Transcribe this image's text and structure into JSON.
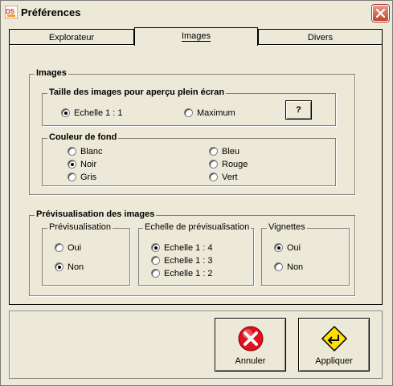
{
  "window": {
    "title": "Préférences",
    "app_icon": "ds-app-icon",
    "close_icon": "close-icon"
  },
  "tabs": [
    {
      "label": "Explorateur",
      "active": false
    },
    {
      "label": "Images",
      "active": true
    },
    {
      "label": "Divers",
      "active": false
    }
  ],
  "images_group": {
    "title": "Images",
    "size_group": {
      "title": "Taille des images pour aperçu plein écran",
      "options": [
        {
          "label": "Echelle 1 : 1",
          "checked": true
        },
        {
          "label": "Maximum",
          "checked": false
        }
      ],
      "help_label": "?"
    },
    "bg_group": {
      "title": "Couleur de fond",
      "options": [
        {
          "label": "Blanc",
          "checked": false
        },
        {
          "label": "Noir",
          "checked": true
        },
        {
          "label": "Gris",
          "checked": false
        },
        {
          "label": "Bleu",
          "checked": false
        },
        {
          "label": "Rouge",
          "checked": false
        },
        {
          "label": "Vert",
          "checked": false
        }
      ]
    }
  },
  "preview_group": {
    "title": "Prévisualisation des images",
    "preview": {
      "title": "Prévisualisation",
      "options": [
        {
          "label": "Oui",
          "checked": false
        },
        {
          "label": "Non",
          "checked": true
        }
      ]
    },
    "scale": {
      "title": "Echelle de prévisualisation",
      "options": [
        {
          "label": "Echelle 1 : 4",
          "checked": true
        },
        {
          "label": "Echelle 1 : 3",
          "checked": false
        },
        {
          "label": "Echelle 1 : 2",
          "checked": false
        }
      ]
    },
    "thumbs": {
      "title": "Vignettes",
      "options": [
        {
          "label": "Oui",
          "checked": true
        },
        {
          "label": "Non",
          "checked": false
        }
      ]
    }
  },
  "buttons": {
    "cancel": {
      "label": "Annuler",
      "icon": "cancel-x-icon",
      "color": "#e0101e"
    },
    "apply": {
      "label": "Appliquer",
      "icon": "apply-arrow-icon",
      "color": "#ffe000"
    }
  }
}
